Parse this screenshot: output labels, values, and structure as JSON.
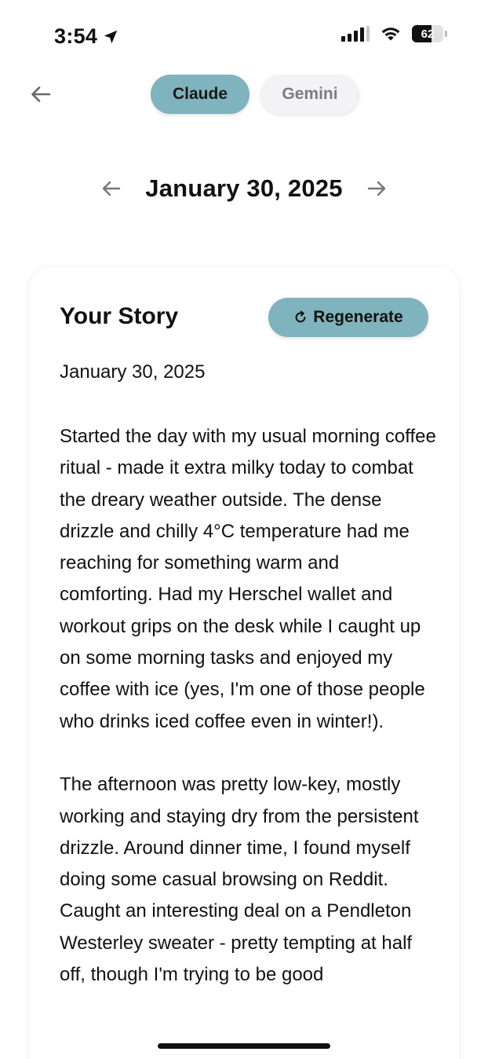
{
  "status_bar": {
    "time": "3:54",
    "battery": "62",
    "battery_level": 0.62,
    "icons": [
      "location-arrow-icon",
      "cellular-signal-icon",
      "wifi-icon",
      "battery-icon"
    ]
  },
  "header": {
    "back_icon": "back-arrow-icon",
    "tabs": [
      {
        "label": "Claude",
        "active": true
      },
      {
        "label": "Gemini",
        "active": false
      }
    ]
  },
  "date_nav": {
    "prev_icon": "left-arrow-icon",
    "date": "January 30, 2025",
    "next_icon": "right-arrow-icon"
  },
  "story_card": {
    "title": "Your Story",
    "regenerate_label": "Regenerate",
    "regenerate_icon": "refresh-icon",
    "date": "January 30, 2025",
    "paragraphs": [
      "Started the day with my usual morning coffee ritual - made it extra milky today to combat the dreary weather outside. The dense drizzle and chilly 4°C temperature had me reaching for something warm and comforting. Had my Herschel wallet and workout grips on the desk while I caught up on some morning tasks and enjoyed my coffee with ice (yes, I'm one of those people who drinks iced coffee even in winter!).",
      "The afternoon was pretty low-key, mostly working and staying dry from the persistent drizzle. Around dinner time, I found myself doing some casual browsing on Reddit. Caught an interesting deal on a Pendleton Westerley sweater - pretty tempting at half off, though I'm trying to be good"
    ]
  },
  "colors": {
    "accent": "#7fb3bd",
    "inactive_tab": "#f3f3f6",
    "inactive_tab_text": "#7d7d7d",
    "text": "#111111"
  }
}
